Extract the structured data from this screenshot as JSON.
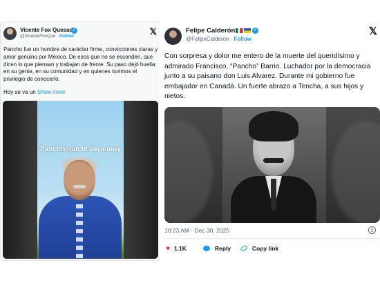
{
  "left_tweet": {
    "author_name": "Vicente Fox Quesada",
    "handle": "@VicenteFoxQue",
    "separator": " · ",
    "follow_label": "Follow",
    "body": "Pancho fue un hombre de carácter firme, convicciones claras y amor genuino por México. De esos que no se esconden, que dicen lo que piensan y trabajan de frente. Su paso dejó huella: en su gente, en su comunidad y en quienes tuvimos el privilegio de conocerlo.",
    "body_tail": "Hoy se va un ",
    "show_more_label": "Show more",
    "video_caption": "Pancho que te vaya muy",
    "verified_icon": "verified-badge-icon",
    "x_icon": "x-logo-icon",
    "colors": {
      "accent": "#1d9bf0",
      "card_bg": "#f7f8f8"
    }
  },
  "right_tweet": {
    "author_name": "Felipe Calderón",
    "handle": "@FelipeCalderon",
    "separator": " · ",
    "follow_label": "Follow",
    "flags": [
      "mexico-flag-icon",
      "ukraine-flag-icon"
    ],
    "body": "Con sorpresa y dolor me entero de la muerte del queridísimo y admirado Francisco, “Pancho” Barrio. Luchador por la democracia junto a su paisano don Luis Alvarez. Durante mi gobierno fue embajador en Canadá. Un fuerte abrazo a Tencha, a sus hijos y nietos.",
    "timestamp": "10:23 AM · Dec 30, 2025",
    "likes_count": "1.1K",
    "reply_label": "Reply",
    "copy_link_label": "Copy link",
    "colors": {
      "like": "#f91880",
      "reply": "#1d9bf0",
      "link": "#00ba7c",
      "muted": "#536471"
    }
  }
}
